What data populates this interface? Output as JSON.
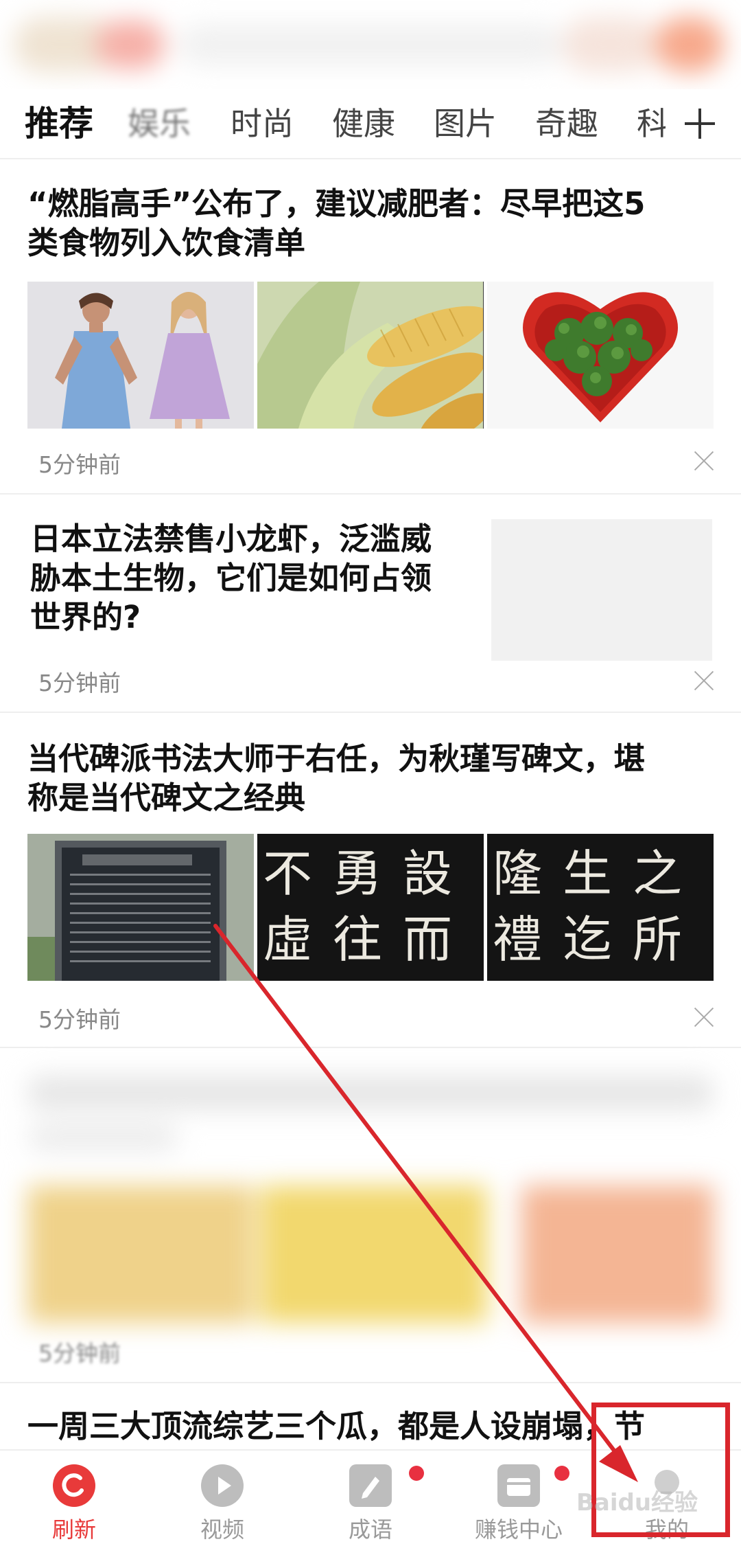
{
  "tabs": [
    "推荐",
    "娱乐",
    "时尚",
    "健康",
    "图片",
    "奇趣",
    "科"
  ],
  "articles": [
    {
      "title_line1": "“燃脂高手”公布了，建议减肥者：尽早把这5",
      "title_line2": "类食物列入饮食清单",
      "time": "5分钟前"
    },
    {
      "title_line1": "日本立法禁售小龙虾，泛滥威",
      "title_line2": "胁本土生物，它们是如何占领",
      "title_line3": "世界的?",
      "time": "5分钟前"
    },
    {
      "title_line1": "当代碑派书法大师于右任，为秋瑾写碑文，堪",
      "title_line2": "称是当代碑文之经典",
      "time": "5分钟前",
      "calligraphy_a": [
        "不",
        "勇",
        "設",
        "虛",
        "往",
        "而"
      ],
      "calligraphy_b": [
        "隆",
        "生",
        "之",
        "禮",
        "迄",
        "所"
      ]
    },
    {
      "time": "5分钟前"
    },
    {
      "title_line1": "一周三大顶流综艺三个瓜，都是人设崩塌，节"
    }
  ],
  "bottom_nav": [
    "刷新",
    "视频",
    "成语",
    "赚钱中心",
    "我的"
  ],
  "watermark": "Baidu经验",
  "colors": {
    "accent": "#e83a3a",
    "annotation": "#d9262c"
  },
  "icons": [
    "plus-icon",
    "close-icon",
    "refresh-icon",
    "play-icon",
    "idiom-icon",
    "wallet-icon",
    "profile-icon"
  ]
}
